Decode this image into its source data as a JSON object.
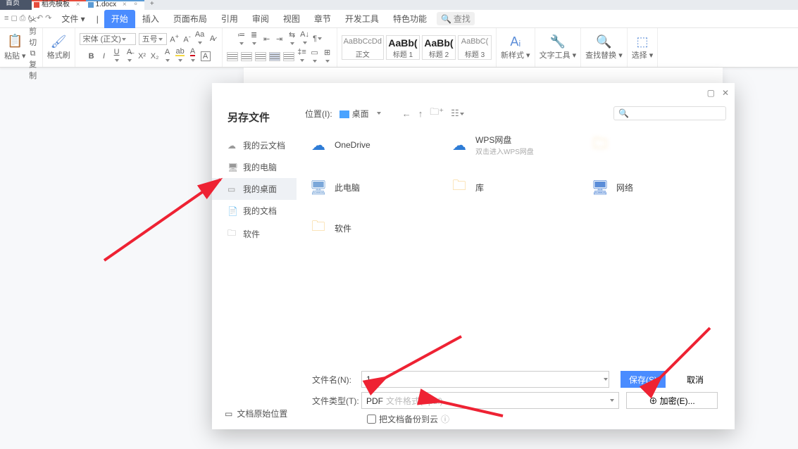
{
  "tabs": {
    "home": "首页",
    "template": "稻壳模板",
    "doc": "1.docx",
    "doc_close": "×",
    "tmpl_close": "×",
    "new": "+"
  },
  "menu": {
    "icons": "≡  ◻  ⎙  ⭮  ↶  ↷",
    "file": "文件 ▾",
    "items": [
      "开始",
      "插入",
      "页面布局",
      "引用",
      "审阅",
      "视图",
      "章节",
      "开发工具",
      "特色功能"
    ],
    "search": "查找",
    "magnifier": "🔍"
  },
  "ribbon": {
    "cut": "✂ 剪切",
    "copy": "⧉ 复制",
    "paste": "粘贴 ▾",
    "fmt": "格式刷",
    "font": "宋体 (正文)",
    "size": "五号",
    "styles": [
      {
        "prev": "AaBbCcDd",
        "lbl": "正文"
      },
      {
        "prev": "AaBb(",
        "lbl": "标题 1"
      },
      {
        "prev": "AaBb(",
        "lbl": "标题 2"
      },
      {
        "prev": "AaBbC(",
        "lbl": "标题 3"
      }
    ],
    "newstyle": "新样式 ▾",
    "texttool": "文字工具 ▾",
    "findrep": "查找替换 ▾",
    "select": "选择 ▾"
  },
  "dialog": {
    "title": "另存文件",
    "side": [
      {
        "icn": "☁",
        "label": "我的云文档"
      },
      {
        "icn": "🖥",
        "label": "我的电脑"
      },
      {
        "icn": "▭",
        "label": "我的桌面"
      },
      {
        "icn": "📄",
        "label": "我的文档"
      },
      {
        "icn": "🗀",
        "label": "软件"
      }
    ],
    "location_label": "位置(I):",
    "location_value": "桌面",
    "searchbox": "🔍",
    "items": [
      {
        "icn": "☁",
        "cls": "cloud",
        "label": "OneDrive"
      },
      {
        "icn": "☁",
        "cls": "cloud",
        "label": "WPS网盘",
        "sub": "双击进入WPS网盘"
      },
      {
        "icn": "🗀",
        "cls": "folder blur",
        "label": ""
      },
      {
        "icn": "🖥",
        "cls": "pc",
        "label": "此电脑"
      },
      {
        "icn": "🗀",
        "cls": "folder",
        "label": "库"
      },
      {
        "icn": "🖥",
        "cls": "net",
        "label": "网络"
      },
      {
        "icn": "🗀",
        "cls": "folder",
        "label": "软件"
      }
    ],
    "filename_label": "文件名(N):",
    "filename_value": "1",
    "filetype_label": "文件类型(T):",
    "filetype_value": "PDF",
    "filetype_hint": "文件格式(*.pdf)",
    "save": "保存(S)",
    "cancel": "取消",
    "encrypt": "⊕  加密(E)...",
    "backup": "把文档备份到云",
    "backup_info": "ⓘ",
    "original": "文档原始位置",
    "orig_icn": "▭"
  }
}
